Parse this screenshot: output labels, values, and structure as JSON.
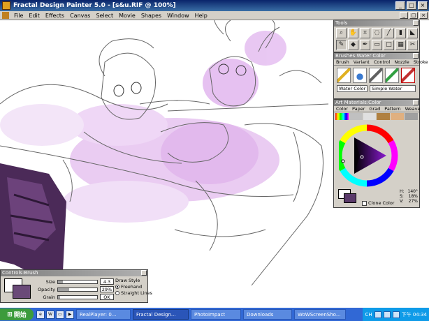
{
  "window": {
    "title": "Fractal Design Painter 5.0 - [s&u.RIF @ 100%]",
    "buttons": {
      "minimize": "_",
      "maximize": "□",
      "close": "×"
    }
  },
  "menubar": {
    "items": [
      "File",
      "Edit",
      "Effects",
      "Canvas",
      "Select",
      "Movie",
      "Shapes",
      "Window",
      "Help"
    ]
  },
  "tools_palette": {
    "title": "Tools",
    "icons": [
      "magnifier-icon",
      "grabber-icon",
      "crop-icon",
      "lasso-icon",
      "line-icon",
      "eraser-icon",
      "paint-bucket-icon",
      "brush-icon",
      "dropper-icon",
      "pen-icon",
      "selection-icon",
      "rect-icon",
      "shape-icon",
      "scissors-icon"
    ]
  },
  "brushes_palette": {
    "title": "Brushes:Water Color",
    "tabs": [
      "Brush",
      "Variant",
      "Control",
      "Nozzle",
      "Stroke"
    ],
    "brush_name": "Water Color",
    "variant_name": "Simple Water"
  },
  "art_materials": {
    "title": "Art Materials:Color",
    "tabs": [
      "Color",
      "Paper",
      "Grad",
      "Pattern",
      "Weave"
    ],
    "hsv": {
      "h_label": "H:",
      "h_value": "140°",
      "s_label": "S:",
      "s_value": "18%",
      "v_label": "V:",
      "v_value": "27%"
    },
    "clone_label": "Clone Color",
    "colors": {
      "current": "#5a3a6a",
      "wheel_selected": "#7a1aa8"
    }
  },
  "controls_palette": {
    "title": "Controls:Brush",
    "size_label": "Size",
    "size_value": "4.3",
    "opacity_label": "Opacity",
    "opacity_value": "29%",
    "grain_label": "Grain",
    "grain_value": "OK",
    "draw_style_label": "Draw Style",
    "freehand_label": "Freehand",
    "straight_label": "Straight Lines"
  },
  "taskbar": {
    "start": "開始",
    "tasks": [
      "RealPlayer: 0...",
      "Fractal Design...",
      "PhotoImpact",
      "Downloads",
      "WoWScreenSho..."
    ],
    "tray_lang": "CH",
    "clock": "下午 04:34"
  }
}
